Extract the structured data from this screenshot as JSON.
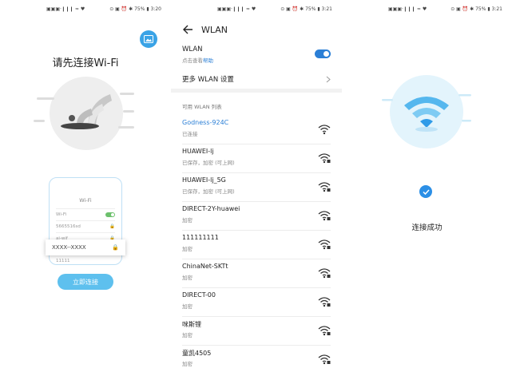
{
  "status_left": "▣▣▣·❙❙❙ ≈ ♥",
  "screens": [
    {
      "status_right": "⊙ ▣ ⏰ ✱ 75% ▮ 3:20",
      "title": "请先连接Wi-Fi",
      "phone": {
        "title": "Wi-Fi",
        "rows": [
          {
            "label": "Wi-Fi"
          },
          {
            "label": "5665516sd"
          },
          {
            "label": "ai-wif"
          },
          {
            "label": "11111"
          }
        ]
      },
      "popup_text": "XXXX--XXXX",
      "connect_button": "立即连接",
      "accent": "#5ec0ee"
    },
    {
      "status_right": "⊙ ▣ ⏰ ✱ 75% ▮ 3:21",
      "title": "WLAN",
      "wlan_label": "WLAN",
      "wlan_sub": "点击查看",
      "wlan_link": "帮助",
      "wlan_enabled": true,
      "settings_label": "更多 WLAN 设置",
      "list_header": "可用 WLAN 列表",
      "networks": [
        {
          "name": "Godness-924C",
          "status": "已连接"
        },
        {
          "name": "HUAWEI-lj",
          "status": "已保存，加密 (可上网)"
        },
        {
          "name": "HUAWEI-lj_5G",
          "status": "已保存，加密 (可上网)"
        },
        {
          "name": "DIRECT-2Y-huawei",
          "status": "加密"
        },
        {
          "name": "111111111",
          "status": "加密"
        },
        {
          "name": "ChinaNet-SKTt",
          "status": "加密"
        },
        {
          "name": "DIRECT-00",
          "status": "加密"
        },
        {
          "name": "咪斯锂",
          "status": "加密"
        },
        {
          "name": "童凯4505",
          "status": "加密"
        }
      ],
      "accent": "#2b7fd6"
    },
    {
      "status_right": "⊙ ▣ ⏰ ✱ 75% ▮ 3:21",
      "message": "连接成功",
      "accent": "#2b8fe6"
    }
  ]
}
